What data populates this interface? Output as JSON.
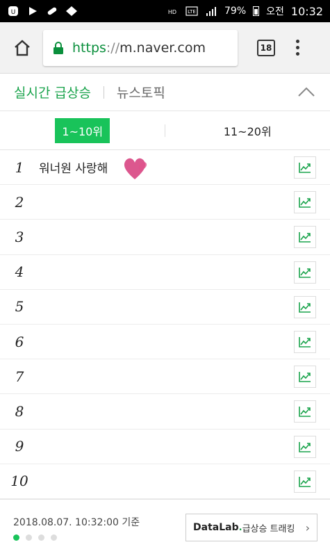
{
  "status_bar": {
    "battery": "79%",
    "ampm": "오전",
    "time": "10:32"
  },
  "browser": {
    "url_scheme": "https",
    "url_sep": "://",
    "url_host": "m.naver.com",
    "tab_count": "18"
  },
  "section": {
    "title_active": "실시간 급상승",
    "title_inactive": "뉴스토픽"
  },
  "ranges": [
    {
      "label": "1~10위",
      "active": true
    },
    {
      "label": "11~20위",
      "active": false
    }
  ],
  "ranking": [
    {
      "rank": "1",
      "keyword": "워너원 사랑해"
    },
    {
      "rank": "2",
      "keyword": ""
    },
    {
      "rank": "3",
      "keyword": ""
    },
    {
      "rank": "4",
      "keyword": ""
    },
    {
      "rank": "5",
      "keyword": ""
    },
    {
      "rank": "6",
      "keyword": ""
    },
    {
      "rank": "7",
      "keyword": ""
    },
    {
      "rank": "8",
      "keyword": ""
    },
    {
      "rank": "9",
      "keyword": ""
    },
    {
      "rank": "10",
      "keyword": ""
    }
  ],
  "footer": {
    "timestamp": "2018.08.07. 10:32:00 기준",
    "datalab_brand": "DataLab",
    "datalab_dot": ".",
    "datalab_label": "급상승 트래킹"
  },
  "colors": {
    "accent_green": "#19c35a",
    "trend_green": "#19a34b"
  }
}
